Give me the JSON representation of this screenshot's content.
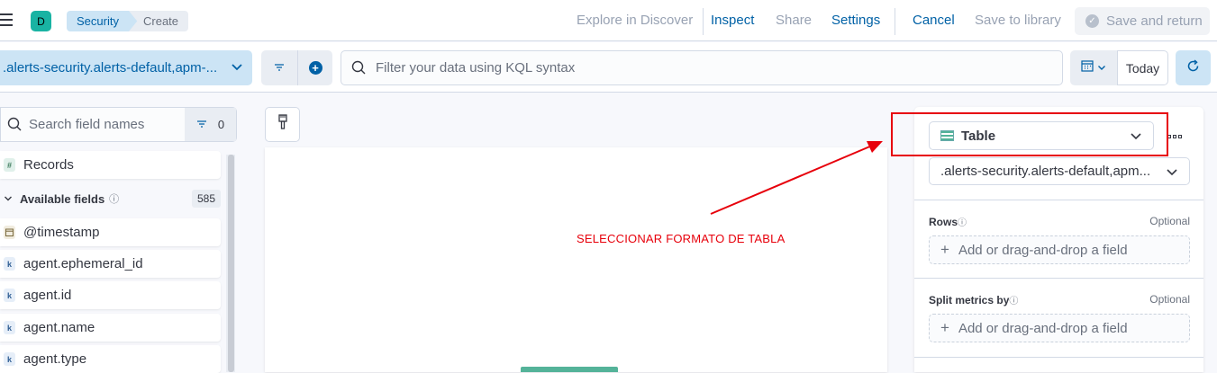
{
  "header": {
    "avatar_letter": "D",
    "breadcrumbs": [
      "Security",
      "Create"
    ],
    "links": {
      "explore": "Explore in Discover",
      "inspect": "Inspect",
      "share": "Share",
      "settings": "Settings",
      "cancel": "Cancel",
      "save_library": "Save to library",
      "save_return": "Save and return"
    }
  },
  "querybar": {
    "data_view": ".alerts-security.alerts-default,apm-...",
    "search_placeholder": "Filter your data using KQL syntax",
    "date_label": "Today"
  },
  "sidebar": {
    "search_placeholder": "Search field names",
    "filter_count": "0",
    "records_label": "Records",
    "available_label": "Available fields",
    "available_count": "585",
    "fields": [
      {
        "name": "@timestamp",
        "type": "date"
      },
      {
        "name": "agent.ephemeral_id",
        "type": "keyword"
      },
      {
        "name": "agent.id",
        "type": "keyword"
      },
      {
        "name": "agent.name",
        "type": "keyword"
      },
      {
        "name": "agent.type",
        "type": "keyword"
      }
    ],
    "tokens": {
      "number": "#",
      "keyword": "k"
    }
  },
  "workspace": {
    "annotation": "SELECCIONAR FORMATO DE TABLA",
    "annotation_color": "#e7000b"
  },
  "config": {
    "chart_type": "Table",
    "data_view": ".alerts-security.alerts-default,apm...",
    "groups": [
      {
        "label": "Rows",
        "optional": "Optional",
        "dropzone": "Add or drag-and-drop a field"
      },
      {
        "label": "Split metrics by",
        "optional": "Optional",
        "dropzone": "Add or drag-and-drop a field"
      }
    ]
  },
  "colors": {
    "accent": "#0061a6",
    "link": "#0077cc",
    "highlight": "#e7000b",
    "table_icon": "#54b399"
  }
}
